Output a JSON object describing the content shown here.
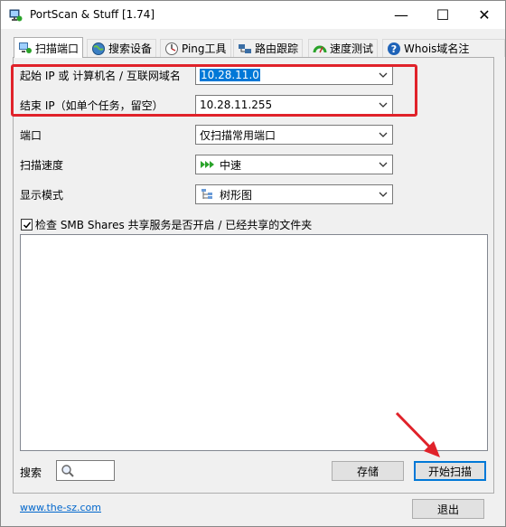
{
  "window": {
    "title": "PortScan & Stuff [1.74]",
    "minimize": "—",
    "maximize": "☐",
    "close": "✕"
  },
  "tabs": [
    {
      "label": "扫描端口",
      "icon": "scan-icon",
      "active": true
    },
    {
      "label": "搜索设备",
      "icon": "globe-icon"
    },
    {
      "label": "Ping工具",
      "icon": "ping-icon"
    },
    {
      "label": "路由跟踪",
      "icon": "route-icon"
    },
    {
      "label": "速度测试",
      "icon": "speed-icon"
    },
    {
      "label": "Whois域名注",
      "icon": "help-icon"
    }
  ],
  "form": {
    "start_ip_label": "起始 IP 或 计算机名 / 互联网域名",
    "start_ip_value": "10.28.11.0",
    "end_ip_label": "结束 IP（如单个任务，留空）",
    "end_ip_value": "10.28.11.255",
    "port_label": "端口",
    "port_value": "仅扫描常用端口",
    "speed_label": "扫描速度",
    "speed_value": "中速",
    "display_label": "显示模式",
    "display_value": "树形图",
    "smb_check_label": "检查 SMB Shares 共享服务是否开启 / 已经共享的文件夹",
    "smb_checked": true
  },
  "bottom": {
    "search_label": "搜索",
    "save_button": "存储",
    "start_button": "开始扫描",
    "website_link": "www.the-sz.com",
    "exit_button": "退出"
  },
  "colors": {
    "highlight": "#e0222a",
    "selection": "#0078d7",
    "link": "#0066cc"
  }
}
